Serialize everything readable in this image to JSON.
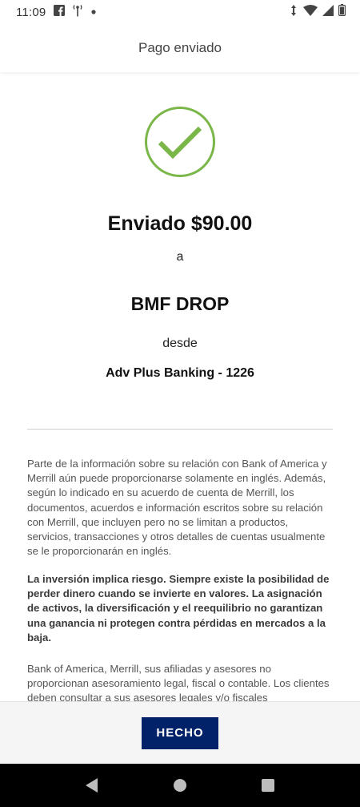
{
  "status_bar": {
    "time": "11:09",
    "left_icons": [
      "facebook-icon",
      "broadcast-icon",
      "dot-icon"
    ],
    "right_icons": [
      "vibrate-icon",
      "wifi-icon",
      "signal-icon",
      "battery-icon"
    ]
  },
  "header": {
    "title": "Pago enviado"
  },
  "confirmation": {
    "icon": "check-circle-icon",
    "sent_label": "Enviado $90.00",
    "to_word": "a",
    "payee": "BMF DROP",
    "from_word": "desde",
    "account": "Adv Plus Banking - 1226"
  },
  "disclosures": {
    "paragraph_1": "Parte de la información sobre su relación con Bank of America y Merrill aún puede proporcionarse solamente en inglés. Además, según lo indicado en su acuerdo de cuenta de Merrill, los documentos, acuerdos e información escritos sobre su relación con Merrill, que incluyen pero no se limitan a productos, servicios, transacciones y otros detalles de cuentas usualmente se le proporcionarán en inglés.",
    "paragraph_2": "La inversión implica riesgo. Siempre existe la posibilidad de perder dinero cuando se invierte en valores. La asignación de activos, la diversificación y el reequilibrio no garantizan una ganancia ni protegen contra pérdidas en mercados a la baja.",
    "paragraph_3": "Bank of America, Merrill, sus afiliadas y asesores no proporcionan asesoramiento legal, fiscal o contable. Los clientes deben consultar a sus asesores legales y/o fiscales"
  },
  "footer": {
    "done_label": "HECHO"
  },
  "colors": {
    "accent_green": "#7ab648",
    "button_navy": "#012169"
  },
  "nav_bar": {
    "icons": [
      "back-icon",
      "home-icon",
      "recents-icon"
    ]
  }
}
